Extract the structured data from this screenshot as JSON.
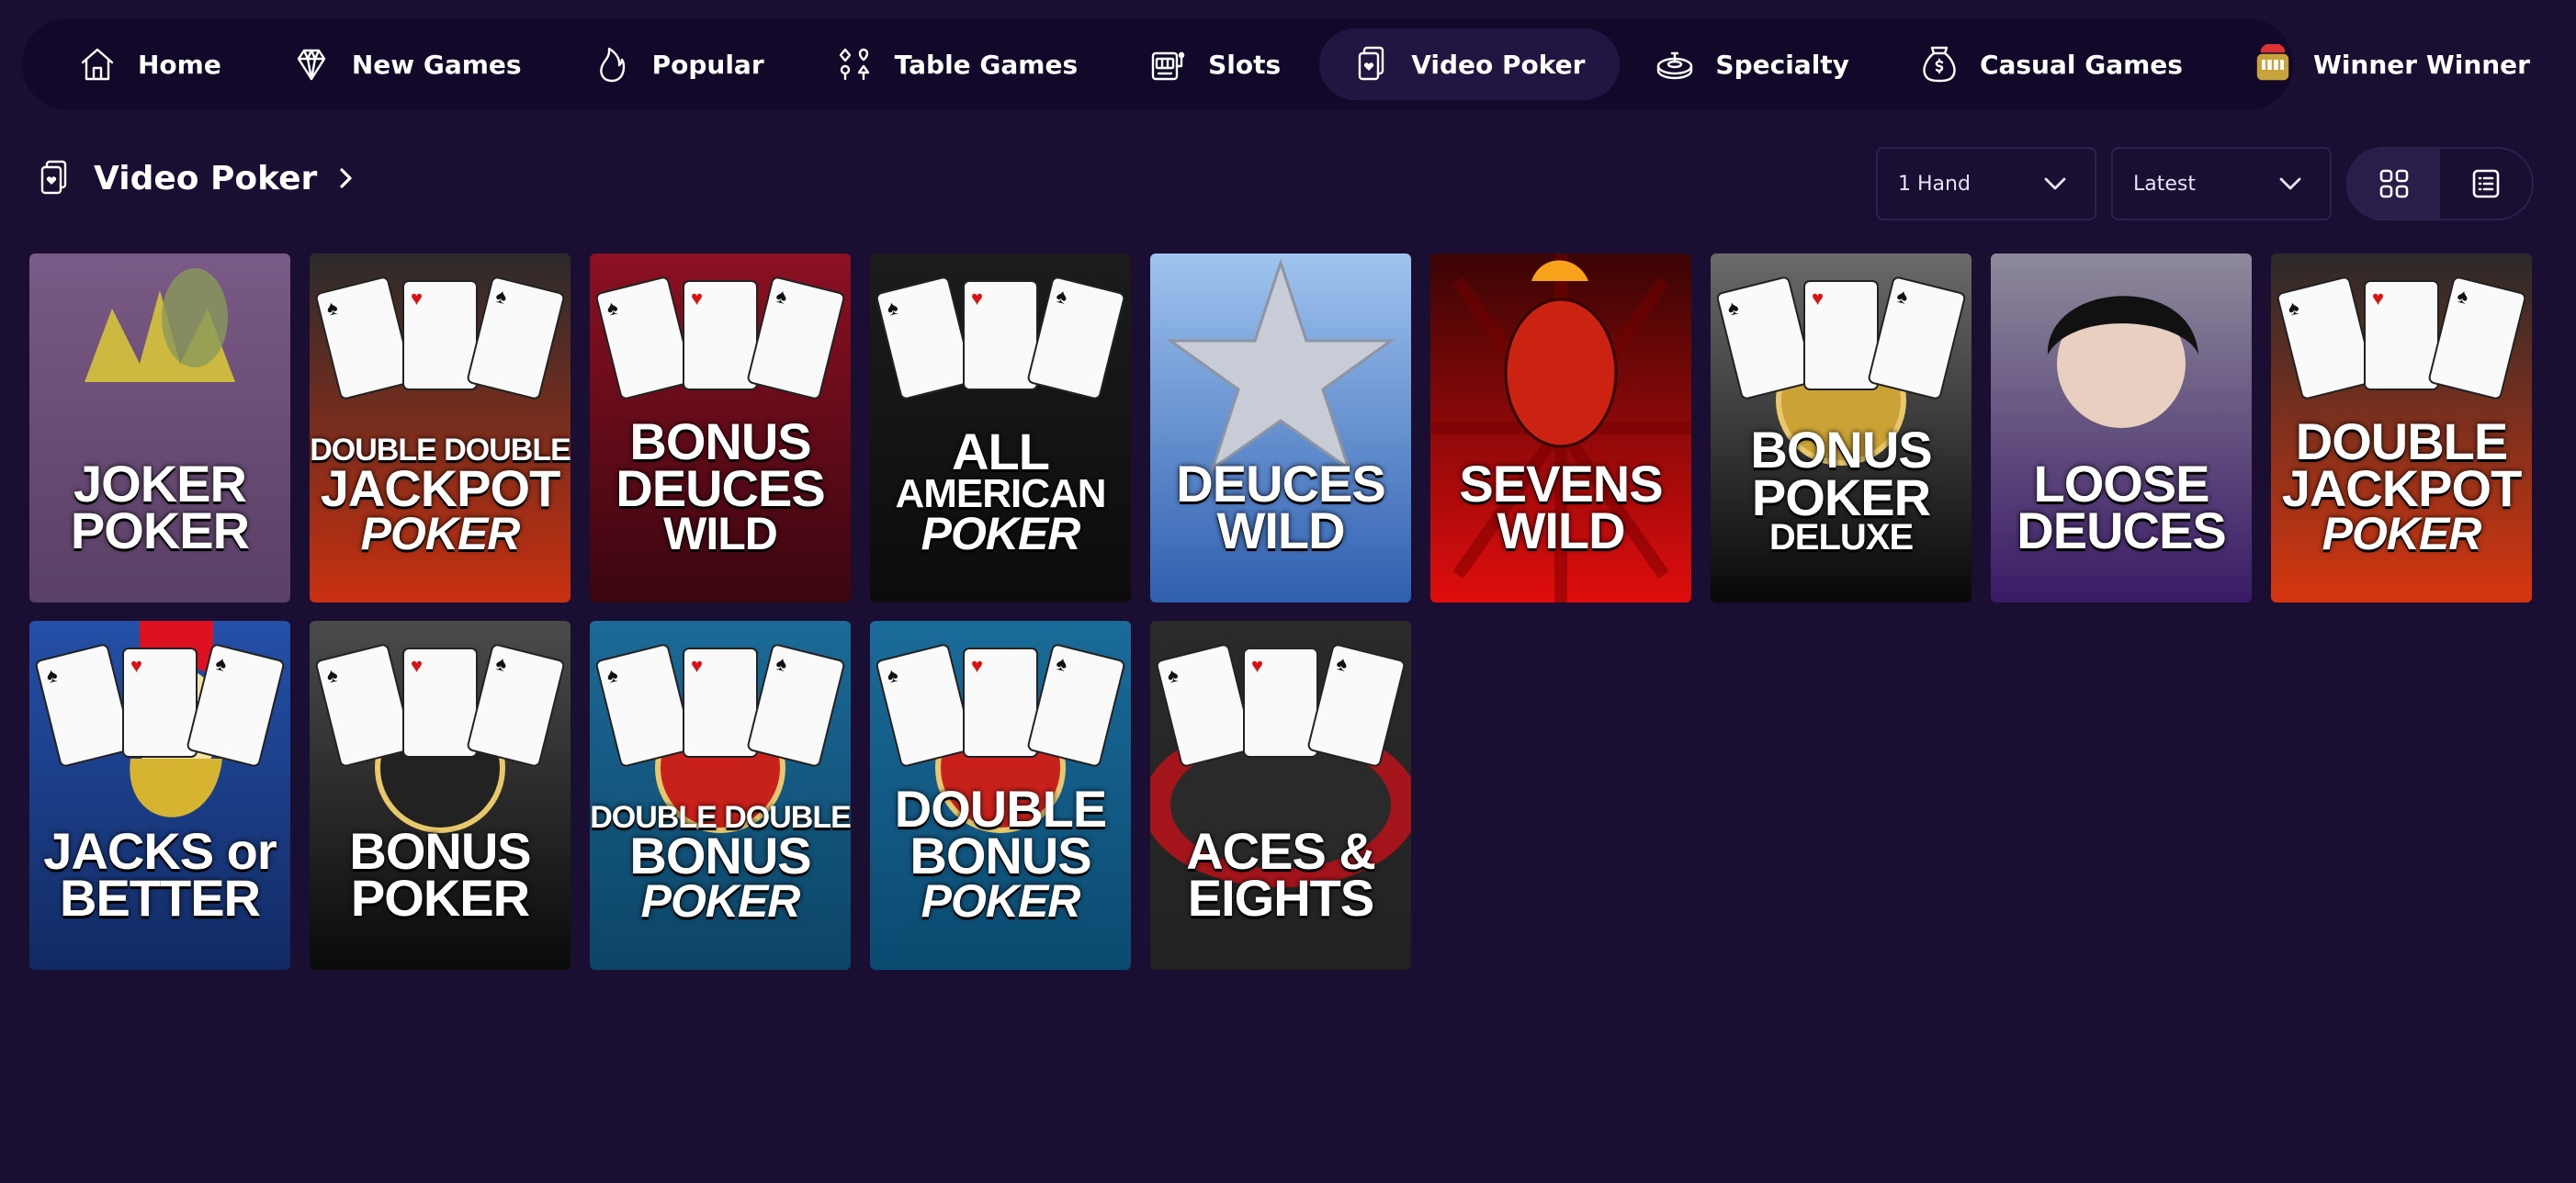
{
  "nav": {
    "items": [
      {
        "label": "Home",
        "icon": "home-icon"
      },
      {
        "label": "New Games",
        "icon": "diamond-icon"
      },
      {
        "label": "Popular",
        "icon": "flame-icon"
      },
      {
        "label": "Table Games",
        "icon": "card-suits-icon"
      },
      {
        "label": "Slots",
        "icon": "slot-machine-icon"
      },
      {
        "label": "Video Poker",
        "icon": "poker-cards-icon",
        "active": true
      },
      {
        "label": "Specialty",
        "icon": "roulette-icon"
      },
      {
        "label": "Casual Games",
        "icon": "money-bag-icon"
      },
      {
        "label": "Winner Winner",
        "icon": "winner-slot-icon"
      }
    ]
  },
  "section": {
    "title": "Video Poker"
  },
  "filters": {
    "hands": "1 Hand",
    "sort": "Latest"
  },
  "games": [
    {
      "line1": "JOKER",
      "line2": "POKER",
      "line3": "",
      "bg": [
        "#7a5a86",
        "#5a3f66"
      ]
    },
    {
      "line1": "DOUBLE DOUBLE",
      "line2": "JACKPOT",
      "line3": "POKER",
      "bg": [
        "#2b2b2b",
        "#c8300f"
      ]
    },
    {
      "line1": "BONUS",
      "line2": "DEUCES",
      "line3": "WILD",
      "bg": [
        "#8c1022",
        "#3a0610"
      ]
    },
    {
      "line1": "ALL",
      "line2": "AMERICAN",
      "line3": "POKER",
      "bg": [
        "#1c1c1c",
        "#0c0c0c"
      ]
    },
    {
      "line1": "DEUCES",
      "line2": "WILD",
      "line3": "",
      "bg": [
        "#9fc4ef",
        "#2f5fb0"
      ]
    },
    {
      "line1": "SEVENS",
      "line2": "WILD",
      "line3": "",
      "bg": [
        "#3a0404",
        "#e00d0d"
      ]
    },
    {
      "line1": "BONUS",
      "line2": "POKER",
      "line3": "DELUXE",
      "bg": [
        "#6a6a6a",
        "#080808"
      ]
    },
    {
      "line1": "LOOSE",
      "line2": "DEUCES",
      "line3": "",
      "bg": [
        "#8e8a9a",
        "#3a1a66"
      ]
    },
    {
      "line1": "DOUBLE",
      "line2": "JACKPOT",
      "line3": "POKER",
      "bg": [
        "#2a2a2a",
        "#d6360f"
      ]
    },
    {
      "line1": "JACKS or",
      "line2": "BETTER",
      "line3": "",
      "bg": [
        "#2450a8",
        "#122a63"
      ]
    },
    {
      "line1": "BONUS",
      "line2": "POKER",
      "line3": "",
      "bg": [
        "#4b4b4b",
        "#0a0a0a"
      ]
    },
    {
      "line1": "DOUBLE DOUBLE",
      "line2": "BONUS",
      "line3": "POKER",
      "bg": [
        "#1b6a98",
        "#0c4466"
      ]
    },
    {
      "line1": "DOUBLE",
      "line2": "BONUS",
      "line3": "POKER",
      "bg": [
        "#1a6b9a",
        "#0b4a70"
      ]
    },
    {
      "line1": "ACES &",
      "line2": "EIGHTS",
      "line3": "",
      "bg": [
        "#2a2a2a",
        "#222222"
      ]
    }
  ]
}
